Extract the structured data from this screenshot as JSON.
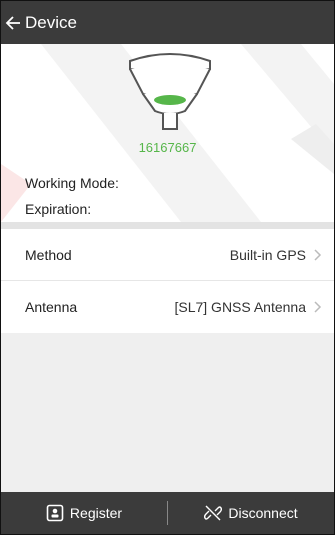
{
  "header": {
    "title": "Device",
    "back_icon": "arrow-left-icon"
  },
  "device": {
    "serial": "16167667",
    "working_mode_label": "Working Mode:",
    "expiration_label": "Expiration:",
    "image_icon": "gnss-receiver-icon"
  },
  "settings": [
    {
      "label": "Method",
      "value": "Built-in GPS"
    },
    {
      "label": "Antenna",
      "value": "[SL7] GNSS Antenna"
    }
  ],
  "footer": {
    "register_label": "Register",
    "register_icon": "register-icon",
    "disconnect_label": "Disconnect",
    "disconnect_icon": "disconnect-icon"
  },
  "colors": {
    "header_bg": "#3b3b3b",
    "accent_green": "#56b64a",
    "background": "#efefef",
    "watermark_red": "#f7e0e0"
  }
}
